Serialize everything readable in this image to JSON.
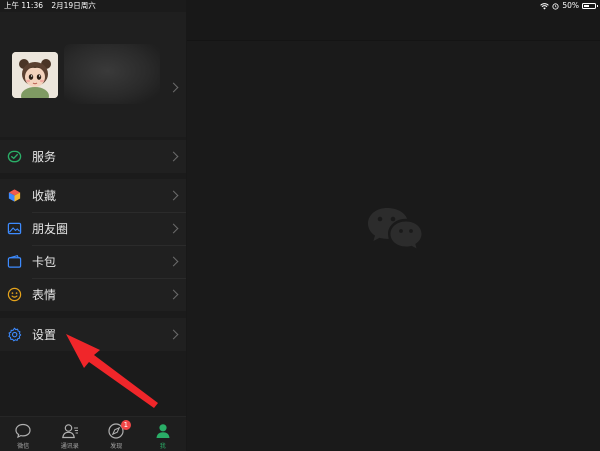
{
  "status_bar": {
    "time": "上午 11:36",
    "date": "2月19日周六",
    "battery": "50%",
    "battery_level": 0.5
  },
  "profile": {
    "avatar_icon": "cartoon-girl-avatar"
  },
  "menu": {
    "services": {
      "label": "服务",
      "icon": "services-icon",
      "color": "#2aae67"
    },
    "favorites": {
      "label": "收藏",
      "icon": "favorites-cube-icon"
    },
    "moments": {
      "label": "朋友圈",
      "icon": "moments-image-icon",
      "color": "#3d8bff"
    },
    "cards": {
      "label": "卡包",
      "icon": "wallet-icon",
      "color": "#3d8bff"
    },
    "stickers": {
      "label": "表情",
      "icon": "smiley-icon",
      "color": "#e5a31b"
    },
    "settings": {
      "label": "设置",
      "icon": "gear-icon",
      "color": "#3d8bff"
    }
  },
  "tab_bar": {
    "tabs": [
      {
        "label": "微信",
        "icon": "chat-bubble-icon"
      },
      {
        "label": "通讯录",
        "icon": "contacts-icon"
      },
      {
        "label": "发现",
        "icon": "compass-icon",
        "badge": "1"
      },
      {
        "label": "我",
        "icon": "person-icon",
        "active": true
      }
    ]
  },
  "colors": {
    "accent_green": "#2aae67",
    "badge_red": "#f04747",
    "annotation_red": "#f0262a"
  }
}
